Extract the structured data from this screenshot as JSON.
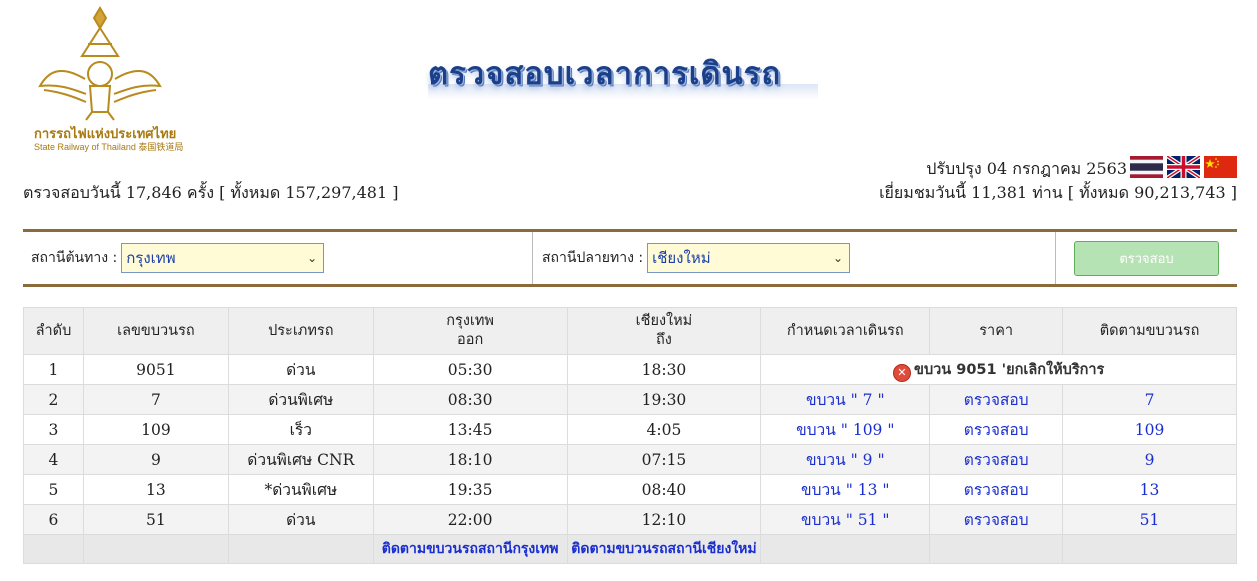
{
  "header": {
    "logo_text_th": "การรถไฟแห่งประเทศไทย",
    "logo_text_en": "State Railway of Thailand 泰国铁道局",
    "title": "ตรวจสอบเวลาการเดินรถ",
    "updated": "ปรับปรุง 04 กรกฎาคม 2563",
    "flags": [
      "thai-flag-icon",
      "uk-flag-icon",
      "china-flag-icon"
    ],
    "check_stat": "ตรวจสอบวันนี้ 17,846 ครั้ง [ ทั้งหมด  157,297,481  ]",
    "visit_stat": "เยี่ยมชมวันนี้ 11,381 ท่าน [ ทั้งหมด  90,213,743 ]"
  },
  "search": {
    "origin_label": "สถานีต้นทาง :",
    "origin_value": "กรุงเทพ",
    "destination_label": "สถานีปลายทาง :",
    "destination_value": "เชียงใหม่",
    "button_label": "ตรวจสอบ"
  },
  "table": {
    "headers": {
      "no": "ลำดับ",
      "train_no": "เลขขบวนรถ",
      "type": "ประเภทรถ",
      "origin_station": "กรุงเทพ",
      "origin_sub": "ออก",
      "dest_station": "เชียงใหม่",
      "dest_sub": "ถึง",
      "schedule": "กำหนดเวลาเดินรถ",
      "price": "ราคา",
      "track": "ติดตามขบวนรถ"
    },
    "rows": [
      {
        "no": "1",
        "train": "9051",
        "type": "ด่วน",
        "depart": "05:30",
        "arrive": "18:30",
        "cancel": "ขบวน 9051 'ยกเลิกให้บริการ"
      },
      {
        "no": "2",
        "train": "7",
        "type": "ด่วนพิเศษ",
        "depart": "08:30",
        "arrive": "19:30",
        "schedule": "ขบวน \" 7 \"",
        "price": "ตรวจสอบ",
        "track": "7"
      },
      {
        "no": "3",
        "train": "109",
        "type": "เร็ว",
        "depart": "13:45",
        "arrive": "4:05",
        "schedule": "ขบวน \" 109 \"",
        "price": "ตรวจสอบ",
        "track": "109"
      },
      {
        "no": "4",
        "train": "9",
        "type": "ด่วนพิเศษ CNR",
        "depart": "18:10",
        "arrive": "07:15",
        "schedule": "ขบวน \" 9 \"",
        "price": "ตรวจสอบ",
        "track": "9"
      },
      {
        "no": "5",
        "train": "13",
        "type": "*ด่วนพิเศษ",
        "depart": "19:35",
        "arrive": "08:40",
        "schedule": "ขบวน \" 13 \"",
        "price": "ตรวจสอบ",
        "track": "13"
      },
      {
        "no": "6",
        "train": "51",
        "type": "ด่วน",
        "depart": "22:00",
        "arrive": "12:10",
        "schedule": "ขบวน \" 51 \"",
        "price": "ตรวจสอบ",
        "track": "51"
      }
    ],
    "footer": {
      "track_origin": "ติดตามขบวนรถสถานีกรุงเทพ",
      "track_dest": "ติดตามขบวนรถสถานีเชียงใหม่"
    }
  },
  "colors": {
    "link": "#1a2ed0",
    "title": "#1c3f8a",
    "border": "#8c6a3c",
    "button": "#b6e3b4"
  }
}
